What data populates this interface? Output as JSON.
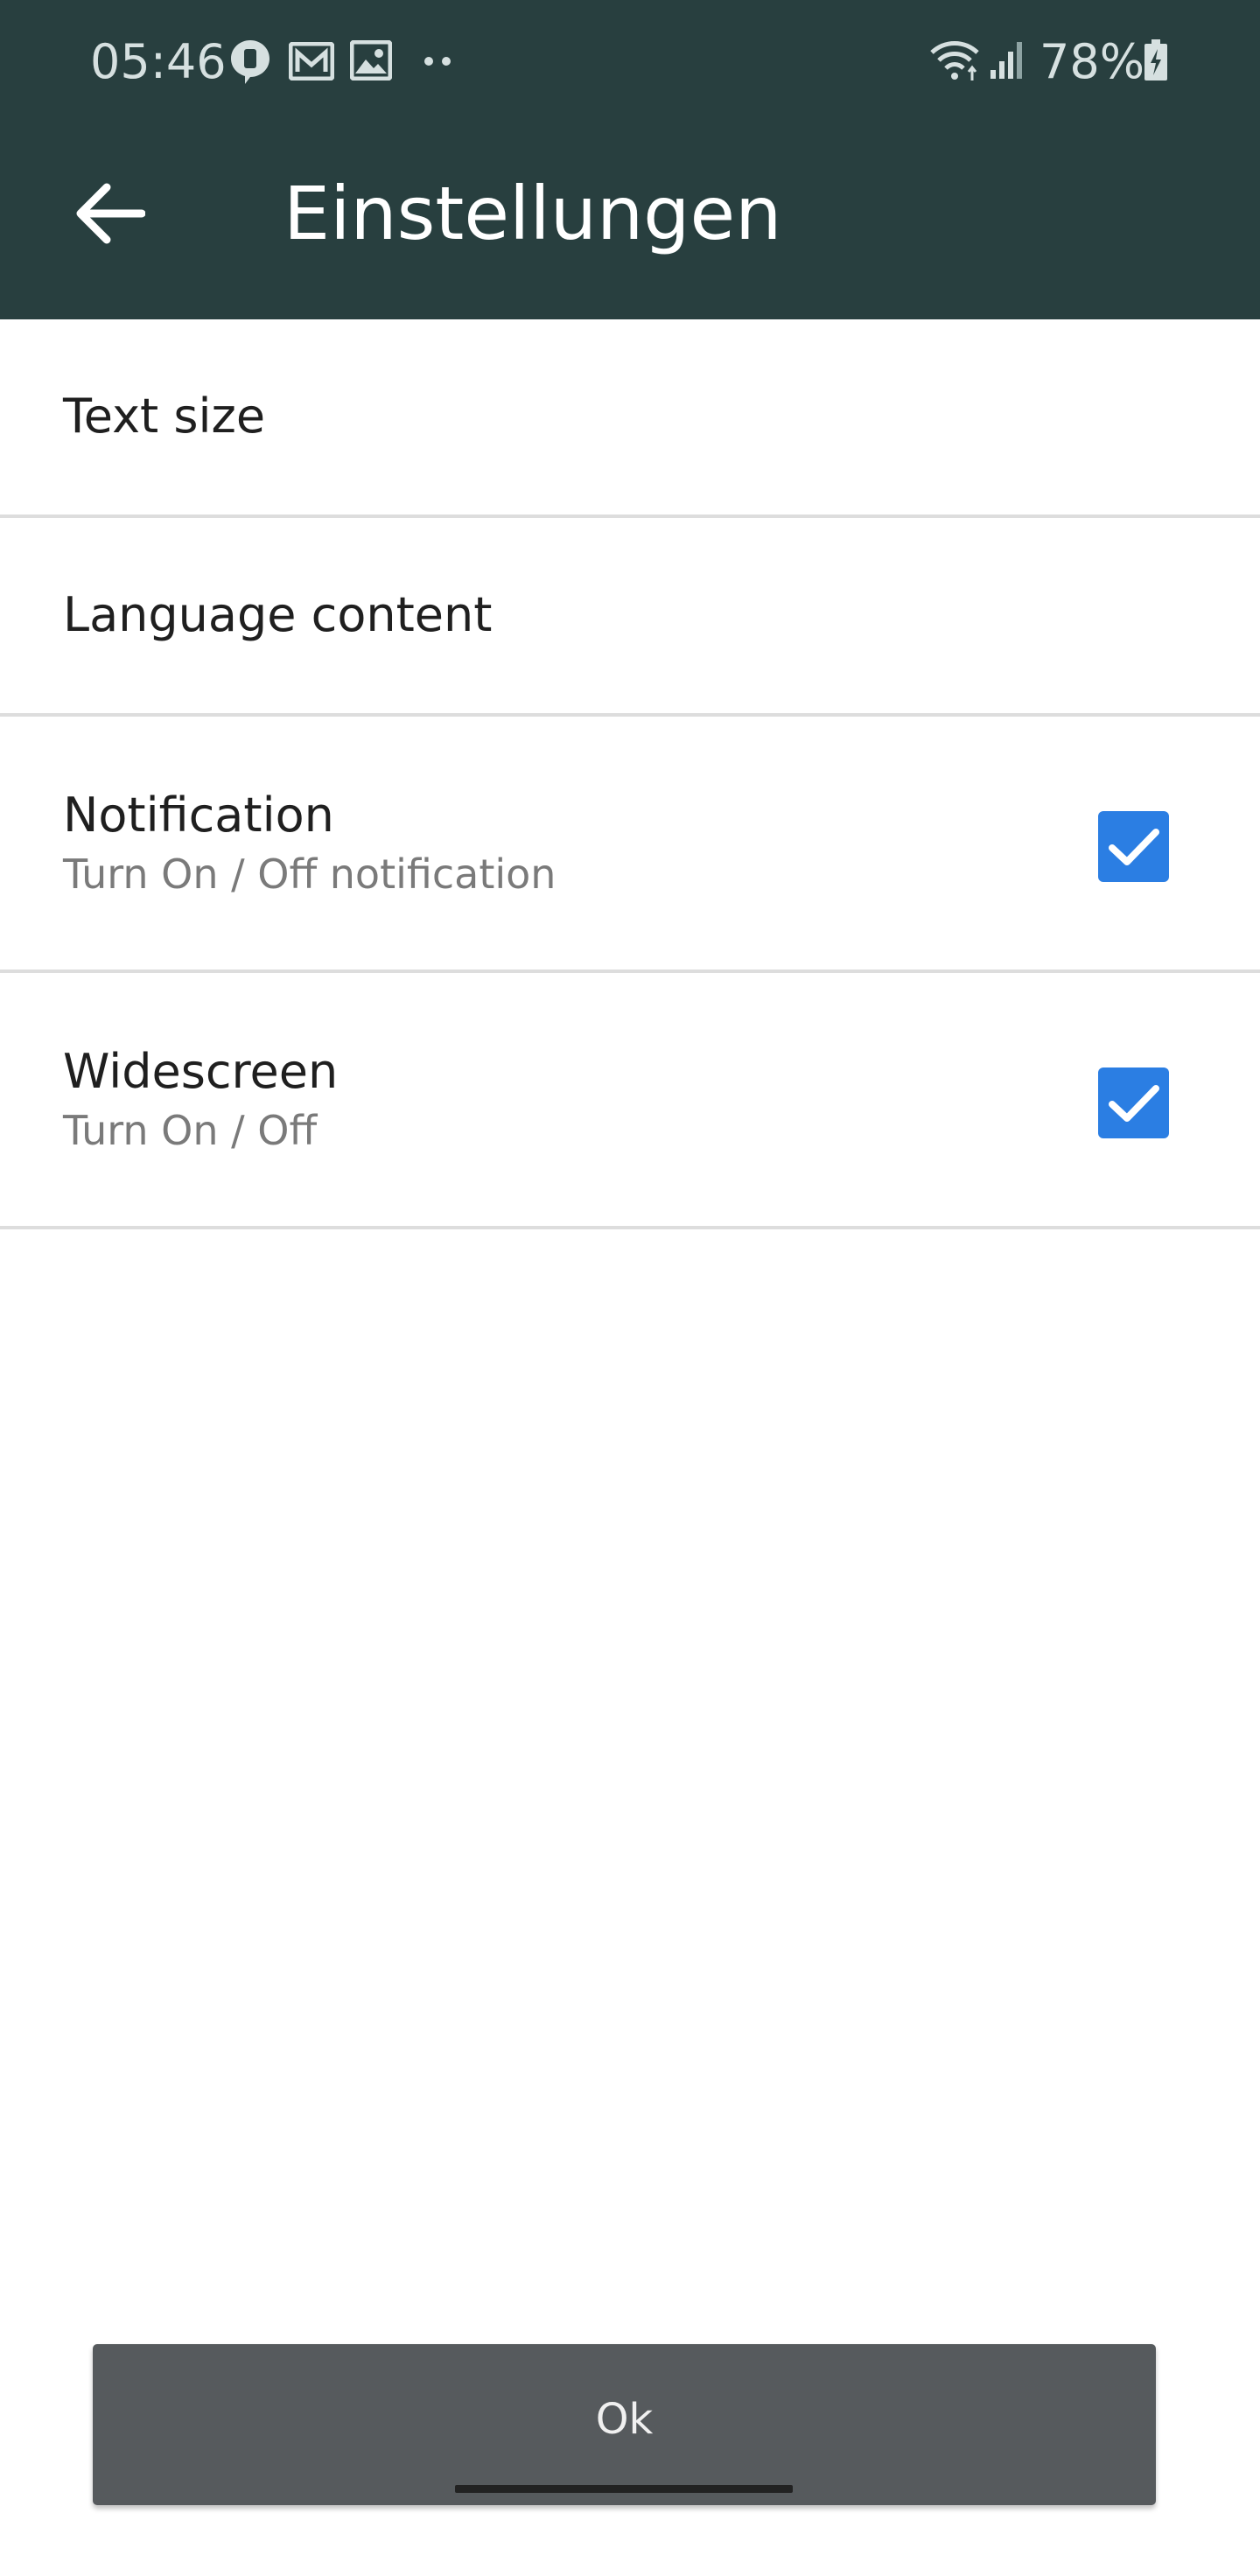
{
  "status_bar": {
    "time": "05:46",
    "battery_percent": "78%",
    "left_icons": [
      "chat-notification-icon",
      "mail-icon",
      "gallery-icon",
      "more-dots-icon"
    ],
    "right_icons": [
      "wifi-icon",
      "signal-icon",
      "battery-charging-icon"
    ]
  },
  "app_bar": {
    "title": "Einstellungen",
    "back_icon": "arrow-left-icon",
    "background_color": "#283f3f"
  },
  "settings": [
    {
      "title": "Text size"
    },
    {
      "title": "Language content"
    },
    {
      "title": "Notification",
      "subtitle": "Turn On / Off notification",
      "checked": true
    },
    {
      "title": "Widescreen",
      "subtitle": "Turn On / Off",
      "checked": true
    }
  ],
  "ok_button": {
    "label": "Ok"
  },
  "colors": {
    "accent_checkbox": "#2b7ee3",
    "button_background": "#565a5d",
    "divider": "#dddddd"
  }
}
